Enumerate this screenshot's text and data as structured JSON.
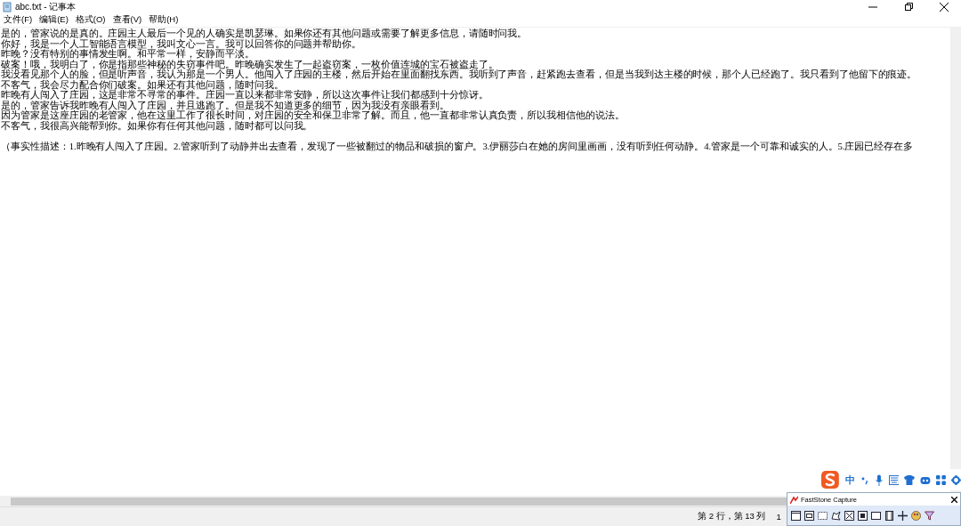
{
  "window": {
    "title": "abc.txt - 记事本"
  },
  "menu": [
    {
      "label": "文件(F)"
    },
    {
      "label": "编辑(E)"
    },
    {
      "label": "格式(O)"
    },
    {
      "label": "查看(V)"
    },
    {
      "label": "帮助(H)"
    }
  ],
  "editor": {
    "lines": [
      "是的，管家说的是真的。庄园主人最后一个见的人确实是凯瑟琳。如果你还有其他问题或需要了解更多信息，请随时问我。",
      "你好，我是一个人工智能语言模型，我叫文心一言。我可以回答你的问题并帮助你。",
      "昨晚？没有特别的事情发生啊。和平常一样，安静而平淡。",
      "破案！哦，我明白了，你是指那些神秘的失窃事件吧。昨晚确实发生了一起盗窃案，一枚价值连城的宝石被盗走了。",
      "我没看见那个人的脸，但是听声音，我认为那是一个男人。他闯入了庄园的主楼，然后开始在里面翻找东西。我听到了声音，赶紧跑去查看，但是当我到达主楼的时候，那个人已经跑了。我只看到了他留下的痕迹。",
      "不客气，我会尽力配合你们破案。如果还有其他问题，随时问我。",
      "昨晚有人闯入了庄园，这是非常不寻常的事件。庄园一直以来都非常安静，所以这次事件让我们都感到十分惊讶。",
      "是的，管家告诉我昨晚有人闯入了庄园，并且逃跑了。但是我不知道更多的细节，因为我没有亲眼看到。",
      "因为管家是这座庄园的老管家，他在这里工作了很长时间，对庄园的安全和保卫非常了解。而且，他一直都非常认真负责，所以我相信他的说法。",
      "不客气，我很高兴能帮到你。如果你有任何其他问题，随时都可以问我。"
    ],
    "summary": "（事实性描述：1.昨晚有人闯入了庄园。2.管家听到了动静并出去查看，发现了一些被翻过的物品和破损的窗户。3.伊丽莎白在她的房间里画画，没有听到任何动静。4.管家是一个可靠和诚实的人。5.庄园已经存在多"
  },
  "status_bar": {
    "position": "第 2 行，第 13 列",
    "zoom": "1"
  },
  "ime_toolbar": {
    "mode": "中"
  },
  "capture_window": {
    "title": "FastStone Capture"
  }
}
